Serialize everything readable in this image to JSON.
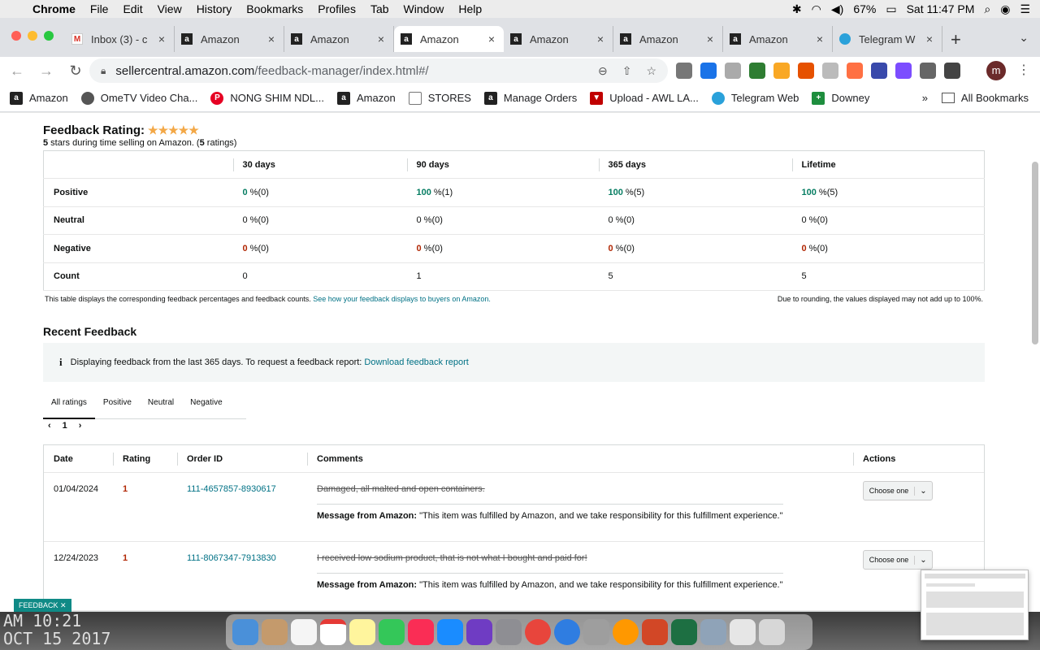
{
  "menubar": {
    "app": "Chrome",
    "items": [
      "File",
      "Edit",
      "View",
      "History",
      "Bookmarks",
      "Profiles",
      "Tab",
      "Window",
      "Help"
    ],
    "battery": "67%",
    "clock": "Sat 11:47 PM"
  },
  "tabs": [
    {
      "title": "Inbox (3) - c",
      "icon": "gmail-icon"
    },
    {
      "title": "Amazon",
      "icon": "amazon-icon"
    },
    {
      "title": "Amazon",
      "icon": "amazon-icon"
    },
    {
      "title": "Amazon",
      "icon": "amazon-icon",
      "active": true
    },
    {
      "title": "Amazon",
      "icon": "amazon-icon"
    },
    {
      "title": "Amazon",
      "icon": "amazon-icon"
    },
    {
      "title": "Amazon",
      "icon": "amazon-icon"
    },
    {
      "title": "Telegram W",
      "icon": "telegram-icon"
    }
  ],
  "address": {
    "host": "sellercentral.amazon.com",
    "path": "/feedback-manager/index.html#/"
  },
  "bookmarks": [
    {
      "label": "Amazon",
      "icon": "amazon-icon",
      "color": "#222222"
    },
    {
      "label": "OmeTV Video Cha...",
      "icon": "globe-icon",
      "color": "#555555"
    },
    {
      "label": "NONG SHIM NDL...",
      "icon": "pinterest-icon",
      "color": "#e60023"
    },
    {
      "label": "Amazon",
      "icon": "amazon-icon",
      "color": "#222222"
    },
    {
      "label": "STORES",
      "icon": "folder-icon",
      "color": "#777777"
    },
    {
      "label": "Manage Orders",
      "icon": "amazon-icon",
      "color": "#222222"
    },
    {
      "label": "Upload - AWL LA...",
      "icon": "triangle-icon",
      "color": "#c00000"
    },
    {
      "label": "Telegram Web",
      "icon": "telegram-icon",
      "color": "#2aa1da"
    },
    {
      "label": "Downey",
      "icon": "plus-icon",
      "color": "#1e8e3e"
    }
  ],
  "bookmarks_more": "»",
  "all_bookmarks": "All Bookmarks",
  "feedback_rating": {
    "title": "Feedback Rating:",
    "stars": "★★★★★",
    "stars_count": "5",
    "sub_mid": " stars during time selling on Amazon. (",
    "ratings_count": "5",
    "sub_end": " ratings)"
  },
  "stats": {
    "headers": [
      "30 days",
      "90 days",
      "365 days",
      "Lifetime"
    ],
    "rows": [
      {
        "label": "Positive",
        "cells": [
          [
            "0",
            " %(0)",
            "g"
          ],
          [
            "100",
            " %(1)",
            "g"
          ],
          [
            "100",
            " %(5)",
            "g"
          ],
          [
            "100",
            " %(5)",
            "g"
          ]
        ]
      },
      {
        "label": "Neutral",
        "cells": [
          [
            "0",
            " %(0)",
            ""
          ],
          [
            "0",
            " %(0)",
            ""
          ],
          [
            "0",
            " %(0)",
            ""
          ],
          [
            "0",
            " %(0)",
            ""
          ]
        ]
      },
      {
        "label": "Negative",
        "cells": [
          [
            "0",
            " %(0)",
            "r"
          ],
          [
            "0",
            " %(0)",
            "r"
          ],
          [
            "0",
            " %(0)",
            "r"
          ],
          [
            "0",
            " %(0)",
            "r"
          ]
        ]
      },
      {
        "label": "Count",
        "cells": [
          [
            "0",
            "",
            ""
          ],
          [
            "1",
            "",
            ""
          ],
          [
            "5",
            "",
            ""
          ],
          [
            "5",
            "",
            ""
          ]
        ]
      }
    ]
  },
  "notes": {
    "left": "This table displays the corresponding feedback percentages and feedback counts. ",
    "left_link": "See how your feedback displays to buyers on Amazon.",
    "right": "Due to rounding, the values displayed may not add up to 100%."
  },
  "recent": {
    "title": "Recent Feedback",
    "info_icon": "i",
    "info": "Displaying feedback from the last 365 days. To request a feedback report: ",
    "info_link": "Download feedback report",
    "filter_tabs": [
      "All ratings",
      "Positive",
      "Neutral",
      "Negative"
    ],
    "page": "1",
    "columns": [
      "Date",
      "Rating",
      "Order ID",
      "Comments",
      "Actions"
    ],
    "rows": [
      {
        "date": "01/04/2024",
        "rating": "1",
        "order_id": "111-4657857-8930617",
        "comment": "Damaged, all malted and open containers.",
        "message_label": "Message from Amazon:",
        "message": " \"This item was fulfilled by Amazon, and we take responsibility for this fulfillment experience.\"",
        "action": "Choose one"
      },
      {
        "date": "12/24/2023",
        "rating": "1",
        "order_id": "111-8067347-7913830",
        "comment": "I received low sodium product, that is not what I bought and paid for!",
        "message_label": "Message from Amazon:",
        "message": " \"This item was fulfilled by Amazon, and we take responsibility for this fulfillment experience.\"",
        "action": "Choose one"
      }
    ]
  },
  "feedback_button": "FEEDBACK ✕",
  "desktop_text": [
    "AM 10:21",
    "OCT 15 2017"
  ]
}
